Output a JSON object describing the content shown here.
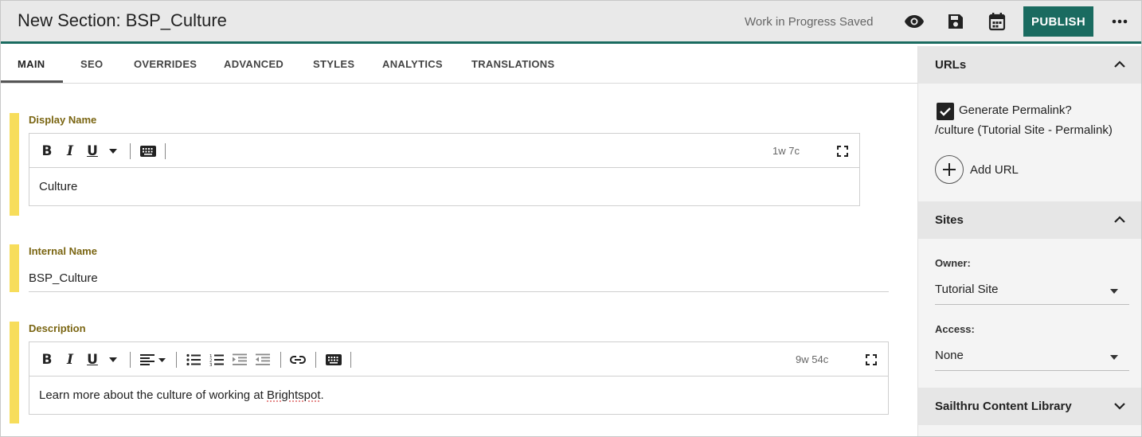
{
  "header": {
    "title": "New Section: BSP_Culture",
    "status": "Work in Progress Saved",
    "publish_label": "PUBLISH",
    "accent_color": "#1a6b60"
  },
  "tabs": [
    {
      "label": "MAIN",
      "active": true
    },
    {
      "label": "SEO"
    },
    {
      "label": "OVERRIDES"
    },
    {
      "label": "ADVANCED"
    },
    {
      "label": "STYLES"
    },
    {
      "label": "ANALYTICS"
    },
    {
      "label": "TRANSLATIONS"
    }
  ],
  "main": {
    "display_name": {
      "label": "Display Name",
      "count": "1w 7c",
      "value": "Culture"
    },
    "internal_name": {
      "label": "Internal Name",
      "value": "BSP_Culture"
    },
    "description": {
      "label": "Description",
      "count": "9w 54c",
      "value_prefix": "Learn more about the culture of working at ",
      "value_spell": "Brightspot",
      "value_suffix": "."
    },
    "required_color": "#f7dd5b"
  },
  "sidebar": {
    "urls": {
      "title": "URLs",
      "generate_permalink_label": "Generate Permalink?",
      "generate_permalink_checked": true,
      "permalink": "/culture (Tutorial Site - Permalink)",
      "add_url_label": "Add URL"
    },
    "sites": {
      "title": "Sites",
      "owner_label": "Owner:",
      "owner_value": "Tutorial Site",
      "access_label": "Access:",
      "access_value": "None"
    },
    "sailthru": {
      "title": "Sailthru Content Library"
    }
  }
}
